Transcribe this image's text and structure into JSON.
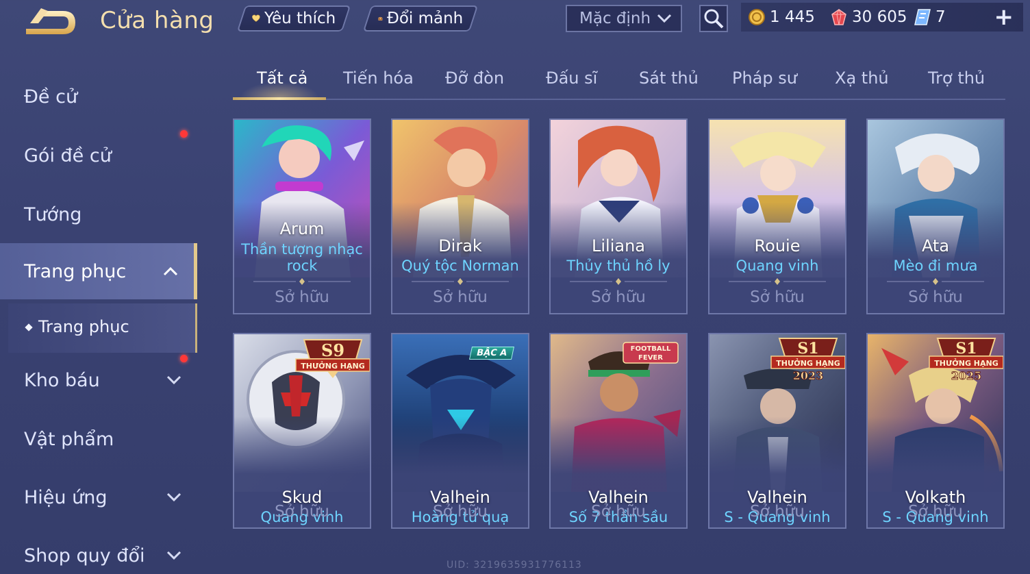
{
  "header": {
    "title": "Cửa hàng",
    "favorite_label": "Yêu thích",
    "shard_exchange_label": "Đổi mảnh",
    "sort_label": "Mặc định",
    "currencies": {
      "gold": "1 445",
      "ruby": "30 605",
      "voucher": "7"
    },
    "add_symbol": "+"
  },
  "sidebar": {
    "items": [
      {
        "label": "Đề cử"
      },
      {
        "label": "Gói đề cử"
      },
      {
        "label": "Tướng"
      },
      {
        "label": "Trang phục"
      },
      {
        "label": "Kho báu"
      },
      {
        "label": "Vật phẩm"
      },
      {
        "label": "Hiệu ứng"
      },
      {
        "label": "Shop quy đổi"
      }
    ],
    "sub_item": {
      "label": "Trang phục"
    }
  },
  "tabs": [
    {
      "label": "Tất cả"
    },
    {
      "label": "Tiến hóa"
    },
    {
      "label": "Đỡ đòn"
    },
    {
      "label": "Đấu sĩ"
    },
    {
      "label": "Sát thủ"
    },
    {
      "label": "Pháp sư"
    },
    {
      "label": "Xạ thủ"
    },
    {
      "label": "Trợ thủ"
    }
  ],
  "cards": [
    {
      "hero": "Arum",
      "skin_line1": "Thần tượng nhạc",
      "skin_line2": "rock",
      "status": "Sở hữu"
    },
    {
      "hero": "Dirak",
      "skin_line1": "Quý tộc Norman",
      "status": "Sở hữu"
    },
    {
      "hero": "Liliana",
      "skin_line1": "Thủy thủ hồ ly",
      "status": "Sở hữu"
    },
    {
      "hero": "Rouie",
      "skin_line1": "Quang vinh",
      "status": "Sở hữu"
    },
    {
      "hero": "Ata",
      "skin_line1": "Mèo đi mưa",
      "status": "Sở hữu"
    },
    {
      "hero": "Skud",
      "skin_line1": "Quang vinh",
      "status": "Sở hữu",
      "badge_top": "S9",
      "badge_label": "THƯỞNG HẠNG"
    },
    {
      "hero": "Valhein",
      "skin_line1": "Hoàng tử quạ",
      "status": "Sở hữu",
      "badge_label": "BẬC A"
    },
    {
      "hero": "Valhein",
      "skin_line1": "Số 7 thần sầu",
      "status": "Sở hữu",
      "badge_top": "FOOTBALL",
      "badge_label": "FEVER"
    },
    {
      "hero": "Valhein",
      "skin_line1": "S - Quang vinh",
      "status": "Sở hữu",
      "badge_top": "S1",
      "badge_label": "THƯỞNG HẠNG",
      "badge_year": "2023"
    },
    {
      "hero": "Volkath",
      "skin_line1": "S - Quang vinh",
      "status": "Sở hữu",
      "badge_top": "S1",
      "badge_label": "THƯỞNG HẠNG",
      "badge_year": "2025"
    }
  ],
  "uid_text": "UID: 3219635931776113"
}
